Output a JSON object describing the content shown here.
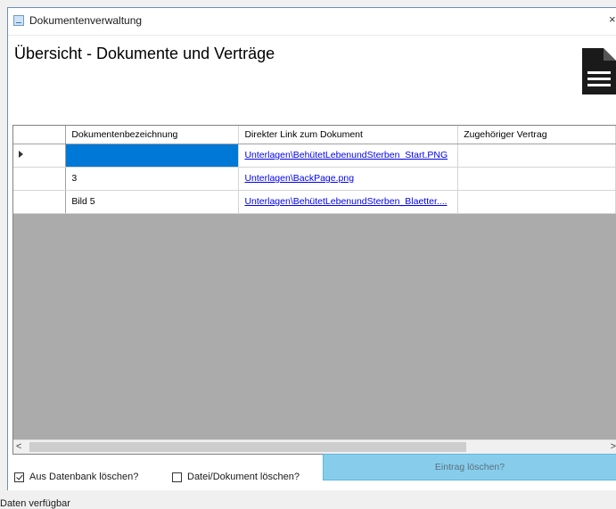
{
  "window": {
    "title": "Dokumentenverwaltung",
    "close_glyph": "×"
  },
  "heading": "Übersicht - Dokumente und Verträge",
  "icons": {
    "app": "document-manager-icon",
    "document": "document-icon",
    "close": "close-icon",
    "row_pointer": "row-pointer-icon",
    "scroll_left": "arrow-left-icon",
    "scroll_right": "arrow-right-icon"
  },
  "grid": {
    "columns": [
      "Dokumentenbezeichnung",
      "Direkter Link zum Dokument",
      "Zugehöriger Vertrag"
    ],
    "rows": [
      {
        "name": "",
        "link": "Unterlagen\\BehütetLebenundSterben_Start.PNG",
        "contract": "",
        "selected": true
      },
      {
        "name": "3",
        "link": "Unterlagen\\BackPage.png",
        "contract": "",
        "selected": false
      },
      {
        "name": "Bild 5",
        "link": "Unterlagen\\BehütetLebenundSterben_Blaetter....",
        "contract": "",
        "selected": false
      }
    ],
    "scroll_left_glyph": "<",
    "scroll_right_glyph": ">"
  },
  "options": {
    "delete_from_db": {
      "label": "Aus Datenbank löschen?",
      "checked": true
    },
    "delete_file": {
      "label": "Datei/Dokument löschen?",
      "checked": false
    }
  },
  "delete_button_label": "Eintrag löschen?",
  "status": "Daten verfügbar",
  "colors": {
    "selection": "#0078d7",
    "button": "#87cdeb",
    "grid_background": "#ababab",
    "link": "#0000ee"
  }
}
